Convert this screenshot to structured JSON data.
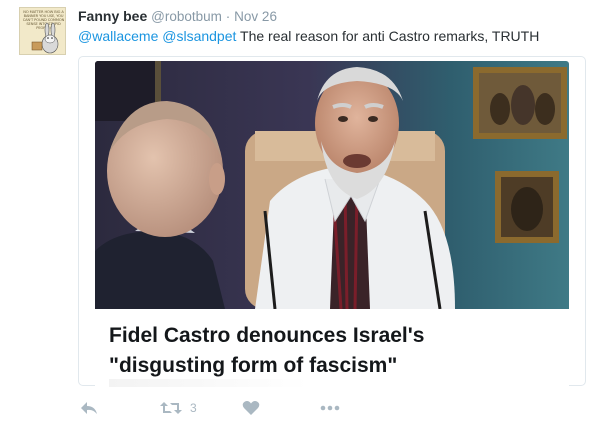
{
  "tweet": {
    "author_name": "Fanny bee",
    "author_handle": "@robotbum",
    "separator": "·",
    "date": "Nov 26",
    "mentions": [
      "@wallaceme",
      "@slsandpet"
    ],
    "text": "The real reason for anti Castro remarks, TRUTH"
  },
  "avatar": {
    "caption": "NO MATTER HOW BIG A BANNER YOU USE, YOU CAN'T POUND COMMON SENSE INTO STUPID PEOPLE!"
  },
  "card": {
    "headline_line1": "Fidel Castro denounces Israel's",
    "headline_line2": "\"disgusting form of fascism\""
  },
  "actions": {
    "retweet_count": "3",
    "icons": [
      "reply-icon",
      "retweet-icon",
      "like-icon",
      "more-icon"
    ]
  },
  "colors": {
    "link": "#1b95e0",
    "muted": "#8899a6",
    "icon": "#aab8c2",
    "border": "#e1e8ed"
  }
}
